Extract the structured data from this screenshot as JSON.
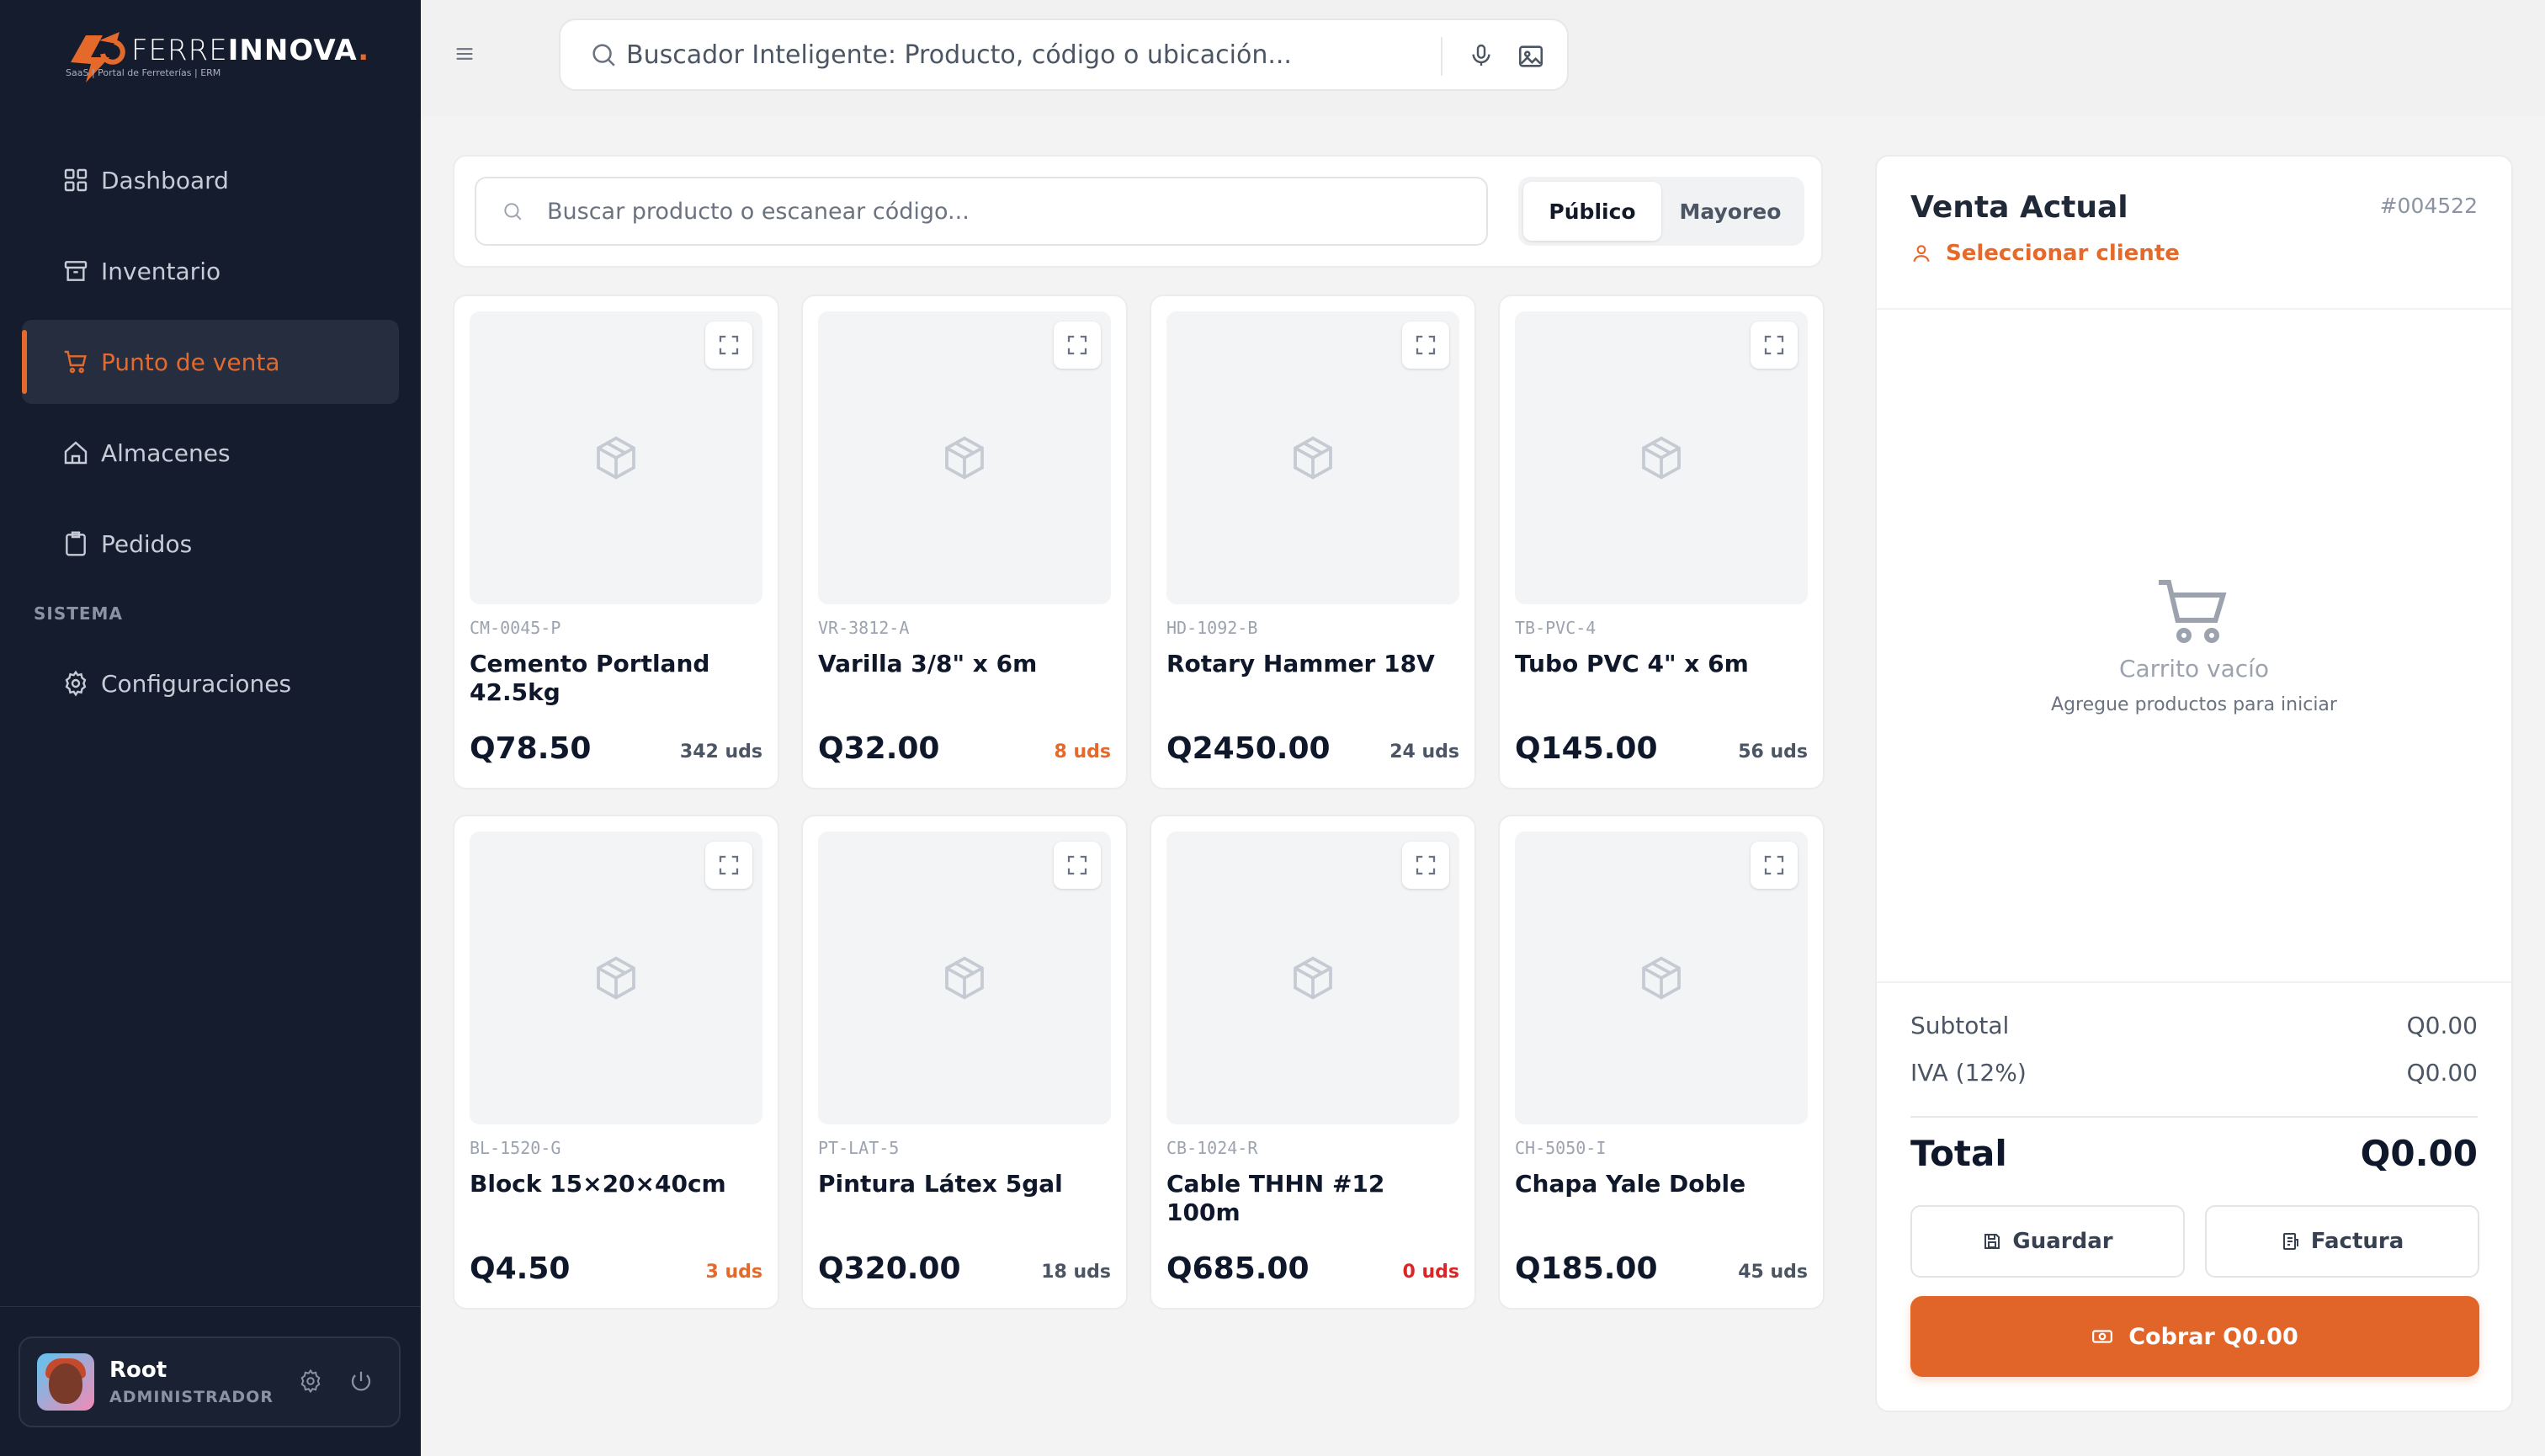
{
  "brand": {
    "name_light": "FERRE",
    "name_bold": "INNOVA",
    "name_dot": ".",
    "subtitle": "SaaS | Portal de Ferreterías | ERM"
  },
  "sidebar": {
    "items": [
      {
        "label": "Dashboard",
        "icon": "grid-icon"
      },
      {
        "label": "Inventario",
        "icon": "archive-icon"
      },
      {
        "label": "Punto de venta",
        "icon": "cart-icon",
        "active": true
      },
      {
        "label": "Almacenes",
        "icon": "home-icon"
      },
      {
        "label": "Pedidos",
        "icon": "clipboard-icon"
      }
    ],
    "section_label": "SISTEMA",
    "system_items": [
      {
        "label": "Configuraciones",
        "icon": "gear-icon"
      }
    ]
  },
  "user": {
    "name": "Root",
    "role": "ADMINISTRADOR"
  },
  "topbar": {
    "search_placeholder": "Buscador Inteligente: Producto, código o ubicación..."
  },
  "pos": {
    "search_placeholder": "Buscar producto o escanear código...",
    "price_modes": [
      "Público",
      "Mayoreo"
    ],
    "active_price_mode": "Público",
    "products": [
      {
        "code": "CM-0045-P",
        "name": "Cemento Portland 42.5kg",
        "price": "Q78.50",
        "stock": "342 uds",
        "stock_status": "normal"
      },
      {
        "code": "VR-3812-A",
        "name": "Varilla 3/8\" x 6m",
        "price": "Q32.00",
        "stock": "8 uds",
        "stock_status": "low"
      },
      {
        "code": "HD-1092-B",
        "name": "Rotary Hammer 18V",
        "price": "Q2450.00",
        "stock": "24 uds",
        "stock_status": "normal"
      },
      {
        "code": "TB-PVC-4",
        "name": "Tubo PVC 4\" x 6m",
        "price": "Q145.00",
        "stock": "56 uds",
        "stock_status": "normal"
      },
      {
        "code": "BL-1520-G",
        "name": "Block 15×20×40cm",
        "price": "Q4.50",
        "stock": "3 uds",
        "stock_status": "low"
      },
      {
        "code": "PT-LAT-5",
        "name": "Pintura Látex 5gal",
        "price": "Q320.00",
        "stock": "18 uds",
        "stock_status": "normal"
      },
      {
        "code": "CB-1024-R",
        "name": "Cable THHN #12 100m",
        "price": "Q685.00",
        "stock": "0 uds",
        "stock_status": "zero"
      },
      {
        "code": "CH-5050-I",
        "name": "Chapa Yale Doble",
        "price": "Q185.00",
        "stock": "45 uds",
        "stock_status": "normal"
      }
    ]
  },
  "cart": {
    "title": "Venta Actual",
    "number": "#004522",
    "select_client": "Seleccionar cliente",
    "empty_title": "Carrito vacío",
    "empty_subtitle": "Agregue productos para iniciar",
    "subtotal_label": "Subtotal",
    "subtotal_value": "Q0.00",
    "iva_label": "IVA (12%)",
    "iva_value": "Q0.00",
    "total_label": "Total",
    "total_value": "Q0.00",
    "save_label": "Guardar",
    "invoice_label": "Factura",
    "pay_label": "Cobrar Q0.00"
  },
  "colors": {
    "accent": "#e4692a",
    "sidebar_bg": "#151c2e",
    "danger": "#dc2626"
  }
}
